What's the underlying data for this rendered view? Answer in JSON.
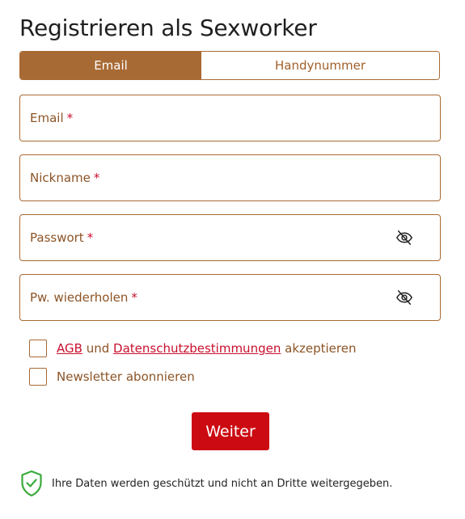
{
  "header": {
    "title": "Registrieren als Sexworker"
  },
  "tabs": [
    {
      "label": "Email",
      "active": true
    },
    {
      "label": "Handynummer",
      "active": false
    }
  ],
  "form": {
    "fields": [
      {
        "label": "Email",
        "required_mark": "*",
        "value": ""
      },
      {
        "label": "Nickname",
        "required_mark": "*",
        "value": ""
      },
      {
        "label": "Passwort",
        "required_mark": "*",
        "value": "",
        "icon": "eye-off-icon"
      },
      {
        "label": "Pw. wiederholen",
        "required_mark": "*",
        "value": "",
        "icon": "eye-off-icon"
      }
    ],
    "terms": {
      "agb_link": "AGB",
      "and_text": "und",
      "privacy_link": "Datenschutzbestimmungen",
      "accept_text": "akzeptieren",
      "checked": false
    },
    "newsletter": {
      "label": "Newsletter abonnieren",
      "checked": false
    },
    "submit_label": "Weiter"
  },
  "footer": {
    "privacy_note": "Ihre Daten werden geschützt und nicht an Dritte weitergegeben.",
    "icon": "shield-check-icon"
  },
  "colors": {
    "accent": "#a86a34",
    "button": "#cc0a12",
    "link": "#c8102e",
    "shield": "#3caa3c"
  }
}
